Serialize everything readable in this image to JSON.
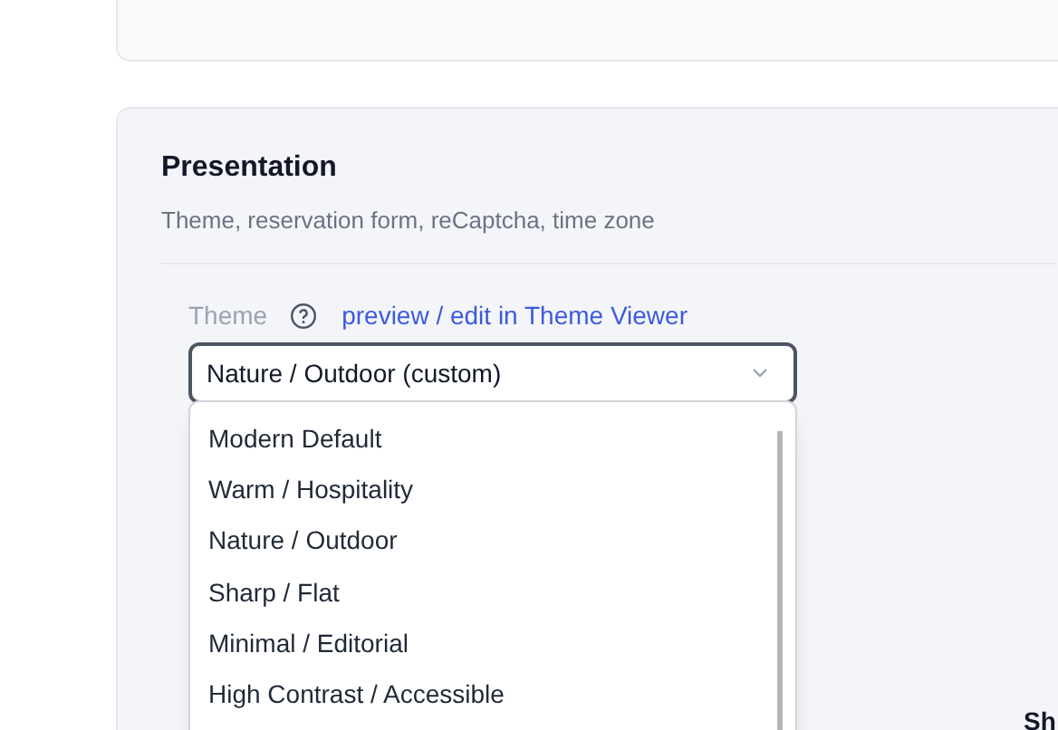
{
  "section": {
    "title": "Presentation",
    "subtitle": "Theme, reservation form, reCaptcha, time zone"
  },
  "theme_field": {
    "label": "Theme",
    "link": "preview / edit in Theme Viewer",
    "value": "Nature / Outdoor (custom)",
    "expanded": true,
    "options": [
      {
        "label": "Modern Default"
      },
      {
        "label": "Warm / Hospitality"
      },
      {
        "label": "Nature / Outdoor"
      },
      {
        "label": "Sharp / Flat"
      },
      {
        "label": "Minimal / Editorial"
      },
      {
        "label": "High Contrast / Accessible"
      }
    ]
  },
  "cut_heading": "Sh"
}
